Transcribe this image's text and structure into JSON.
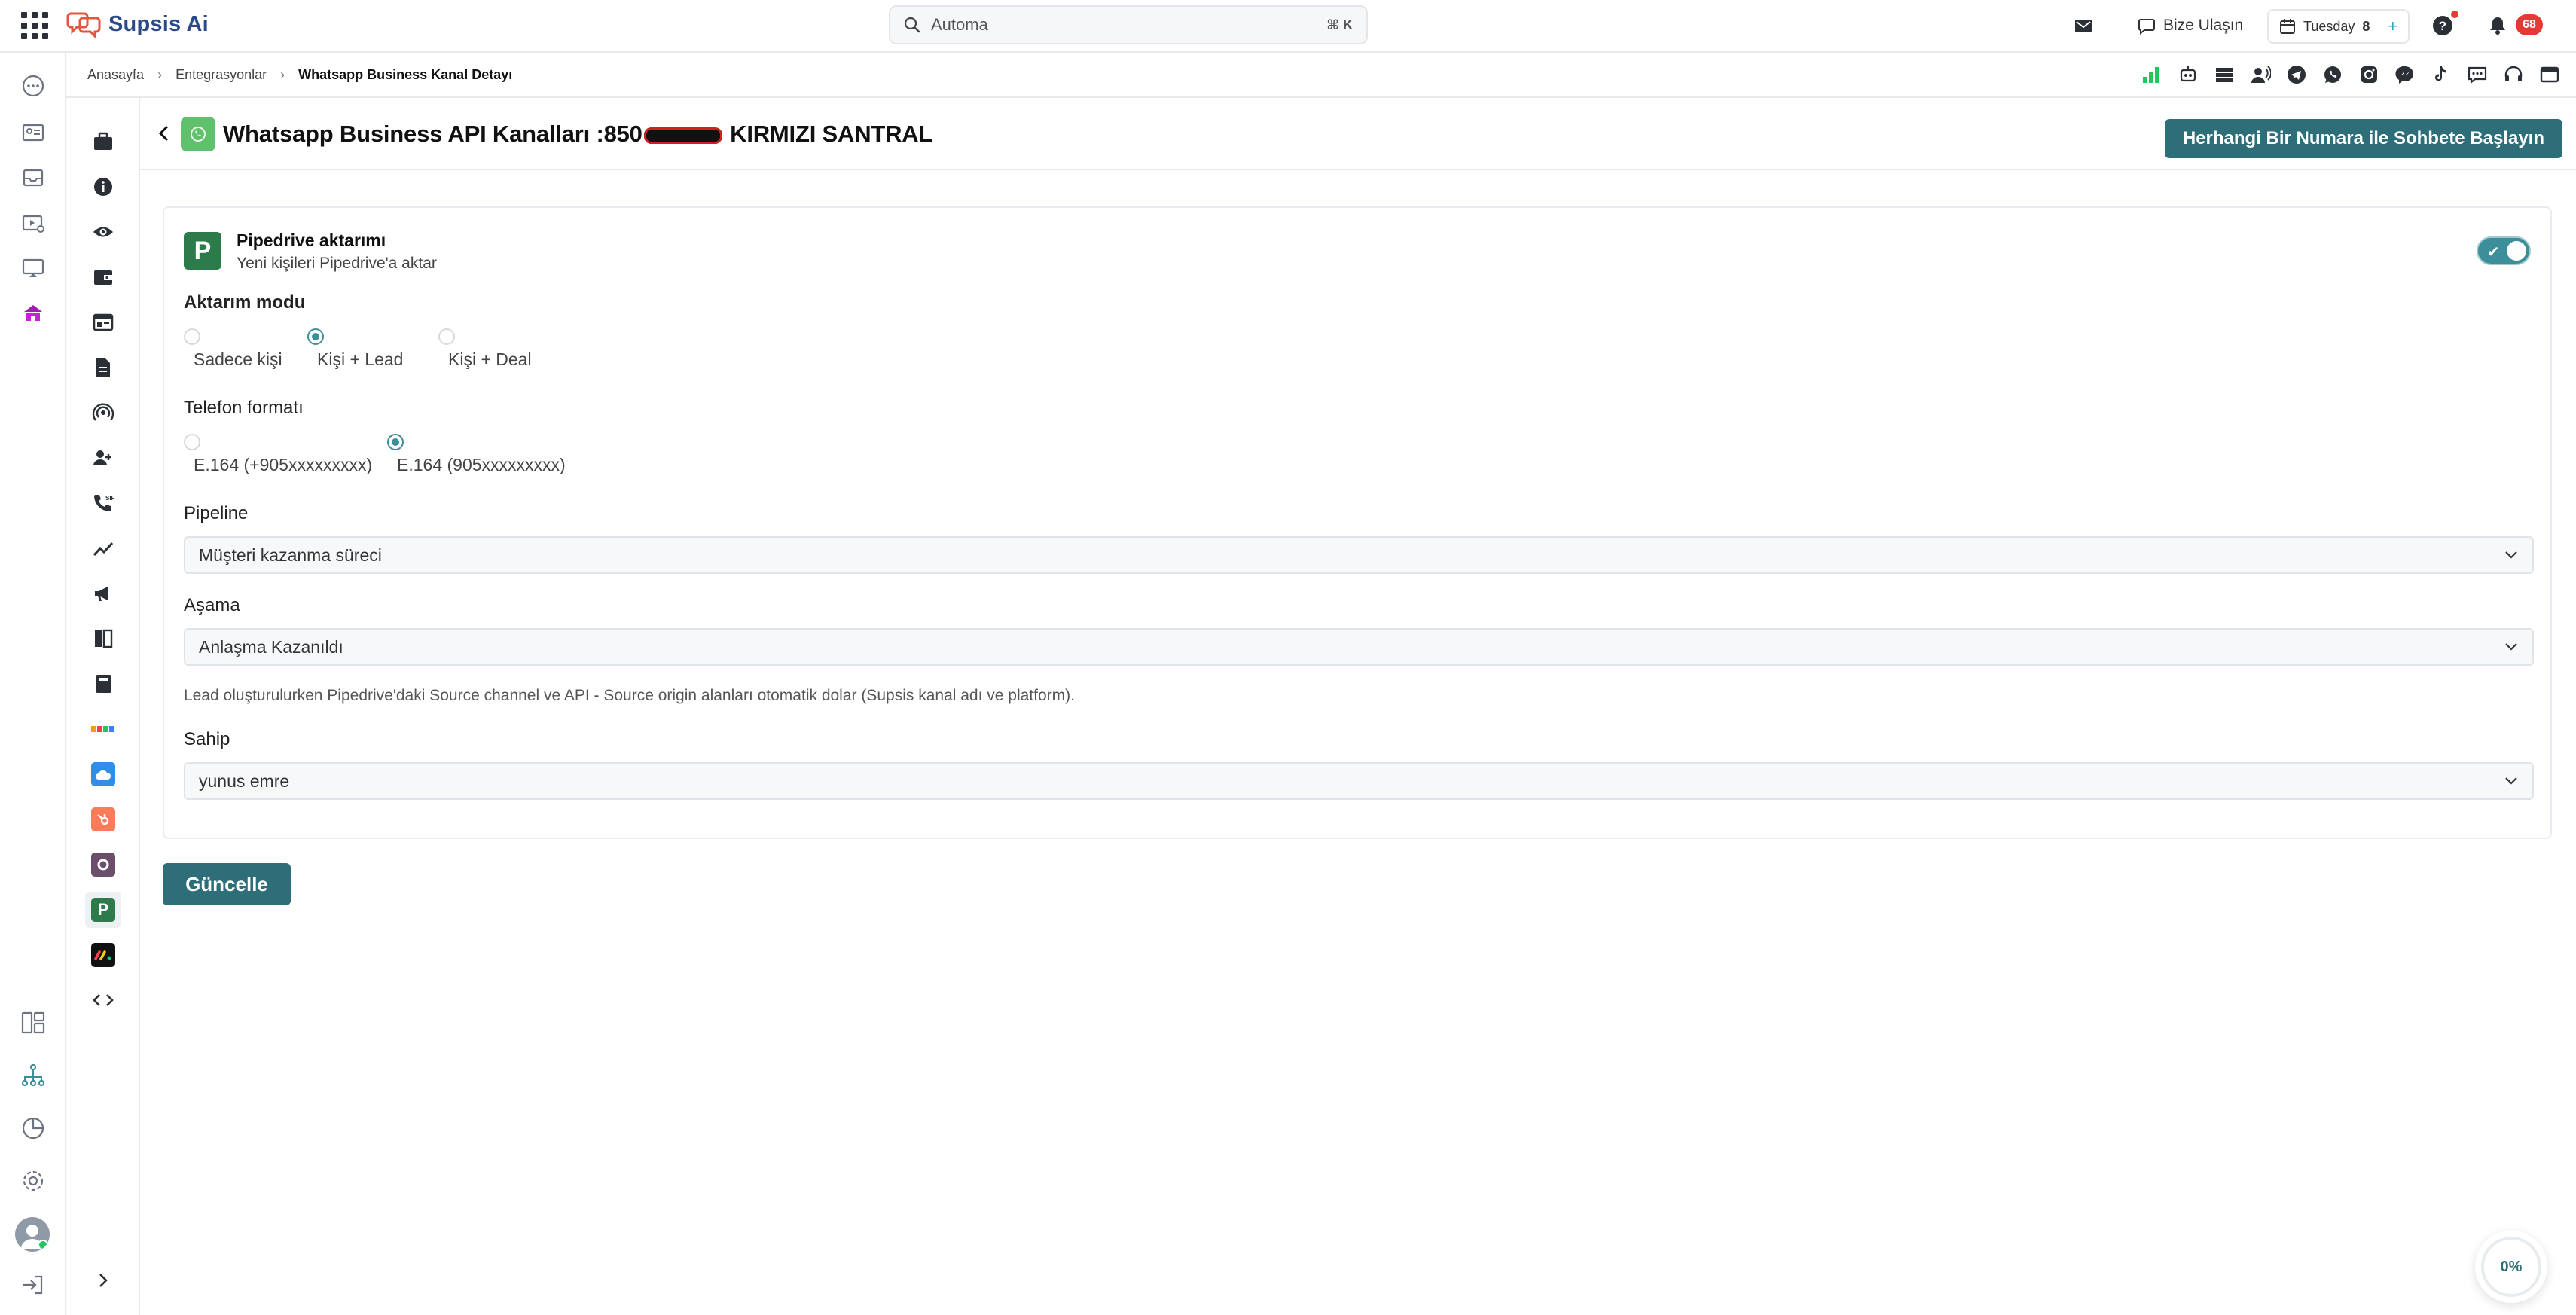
{
  "app": {
    "name": "Supsis Ai"
  },
  "search": {
    "placeholder": "Automa",
    "shortcut": "⌘ K"
  },
  "topbar": {
    "contact": "Bize Ulaşın",
    "day": "Tuesday",
    "date": "8",
    "notifications": "68"
  },
  "breadcrumb": [
    "Anasayfa",
    "Entegrasyonlar",
    "Whatsapp Business Kanal Detayı"
  ],
  "page": {
    "title_prefix": "Whatsapp Business API Kanalları :850",
    "title_suffix": "KIRMIZI SANTRAL",
    "start_chat": "Herhangi Bir Numara ile Sohbete Başlayın"
  },
  "pipedrive": {
    "title": "Pipedrive aktarımı",
    "subtitle": "Yeni kişileri Pipedrive'a aktar",
    "enabled": true,
    "mode_label": "Aktarım modu",
    "modes": [
      "Sadece kişi",
      "Kişi + Lead",
      "Kişi + Deal"
    ],
    "mode_selected": "Kişi + Lead",
    "phone_label": "Telefon formatı",
    "phones": [
      "E.164 (+905xxxxxxxxx)",
      "E.164 (905xxxxxxxxx)"
    ],
    "phone_selected": "E.164 (905xxxxxxxxx)",
    "pipeline_label": "Pipeline",
    "pipeline_value": "Müşteri kazanma süreci",
    "stage_label": "Aşama",
    "stage_value": "Anlaşma Kazanıldı",
    "note": "Lead oluşturulurken Pipedrive'daki Source channel ve API - Source origin alanları otomatik dolar (Supsis kanal adı ve platform).",
    "owner_label": "Sahip",
    "owner_value": "yunus emre"
  },
  "actions": {
    "update": "Güncelle"
  },
  "progress": {
    "value": "0%"
  },
  "colors": {
    "primary": "#2e6e78",
    "accent": "#3b8f9a",
    "pipedrive": "#2d7a4a",
    "whatsapp": "#61c06b",
    "danger": "#e53935"
  }
}
